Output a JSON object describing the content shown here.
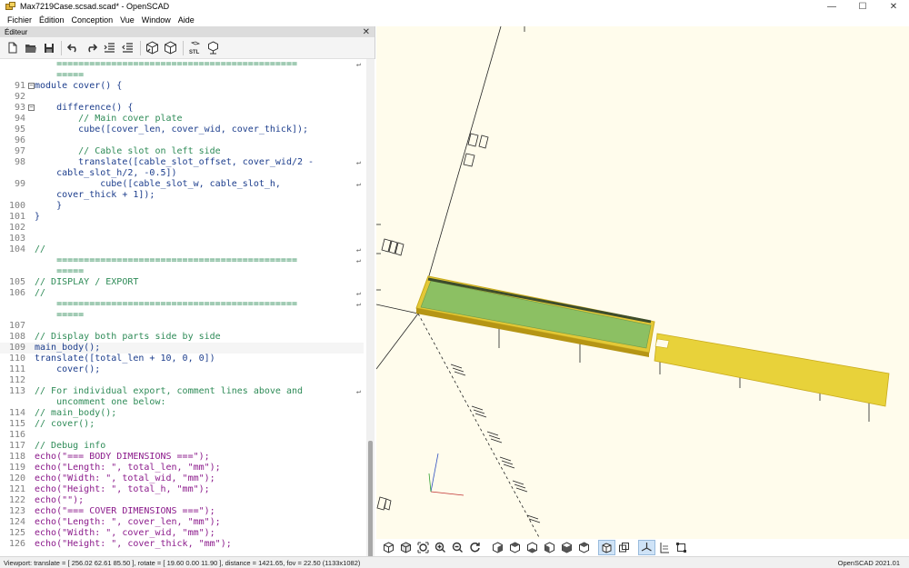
{
  "window": {
    "title": "Max7219Case.scsad.scad* - OpenSCAD",
    "minimize": "—",
    "maximize": "☐",
    "close": "✕"
  },
  "menu": [
    "Fichier",
    "Édition",
    "Conception",
    "Vue",
    "Window",
    "Aide"
  ],
  "editor": {
    "title": "Éditeur",
    "close": "✕",
    "toolbar_icons": [
      "new-file-icon",
      "open-file-icon",
      "save-icon",
      "undo-icon",
      "redo-icon",
      "indent-icon",
      "unindent-icon",
      "preview-icon",
      "render-icon",
      "export-stl-icon",
      "send-to-printer-icon"
    ],
    "lines": [
      {
        "ln": "",
        "text": "    ============================================",
        "cls": "c-comment",
        "wrap": true
      },
      {
        "ln": "",
        "text": "    =====",
        "cls": "c-comment"
      },
      {
        "ln": "91",
        "text": "module cover() {",
        "cls": "c-kw",
        "fold": "⊟"
      },
      {
        "ln": "92",
        "text": "",
        "cls": "c-plain"
      },
      {
        "ln": "93",
        "text": "    difference() {",
        "cls": "c-kw",
        "fold": "⊟"
      },
      {
        "ln": "94",
        "text": "        // Main cover plate",
        "cls": "c-comment"
      },
      {
        "ln": "95",
        "text": "        cube([cover_len, cover_wid, cover_thick]);",
        "cls": "c-kw"
      },
      {
        "ln": "96",
        "text": "",
        "cls": "c-plain"
      },
      {
        "ln": "97",
        "text": "        // Cable slot on left side",
        "cls": "c-comment"
      },
      {
        "ln": "98",
        "text": "        translate([cable_slot_offset, cover_wid/2 -",
        "cls": "c-kw",
        "wrap": true
      },
      {
        "ln": "",
        "text": "    cable_slot_h/2, -0.5])",
        "cls": "c-kw"
      },
      {
        "ln": "99",
        "text": "            cube([cable_slot_w, cable_slot_h,",
        "cls": "c-kw",
        "wrap": true
      },
      {
        "ln": "",
        "text": "    cover_thick + 1]);",
        "cls": "c-kw"
      },
      {
        "ln": "100",
        "text": "    }",
        "cls": "c-kw"
      },
      {
        "ln": "101",
        "text": "}",
        "cls": "c-kw"
      },
      {
        "ln": "102",
        "text": "",
        "cls": "c-plain"
      },
      {
        "ln": "103",
        "text": "",
        "cls": "c-plain"
      },
      {
        "ln": "104",
        "text": "//",
        "cls": "c-comment",
        "wrap": true
      },
      {
        "ln": "",
        "text": "    ============================================",
        "cls": "c-comment",
        "wrap": true
      },
      {
        "ln": "",
        "text": "    =====",
        "cls": "c-comment"
      },
      {
        "ln": "105",
        "text": "// DISPLAY / EXPORT",
        "cls": "c-comment"
      },
      {
        "ln": "106",
        "text": "//",
        "cls": "c-comment",
        "wrap": true
      },
      {
        "ln": "",
        "text": "    ============================================",
        "cls": "c-comment",
        "wrap": true
      },
      {
        "ln": "",
        "text": "    =====",
        "cls": "c-comment"
      },
      {
        "ln": "107",
        "text": "",
        "cls": "c-plain"
      },
      {
        "ln": "108",
        "text": "// Display both parts side by side",
        "cls": "c-comment"
      },
      {
        "ln": "109",
        "text": "main_body();",
        "cls": "c-kw",
        "current": true
      },
      {
        "ln": "110",
        "text": "translate([total_len + 10, 0, 0])",
        "cls": "c-kw"
      },
      {
        "ln": "111",
        "text": "    cover();",
        "cls": "c-kw"
      },
      {
        "ln": "112",
        "text": "",
        "cls": "c-plain"
      },
      {
        "ln": "113",
        "text": "// For individual export, comment lines above and",
        "cls": "c-comment",
        "wrap": true
      },
      {
        "ln": "",
        "text": "    uncomment one below:",
        "cls": "c-comment"
      },
      {
        "ln": "114",
        "text": "// main_body();",
        "cls": "c-comment"
      },
      {
        "ln": "115",
        "text": "// cover();",
        "cls": "c-comment"
      },
      {
        "ln": "116",
        "text": "",
        "cls": "c-plain"
      },
      {
        "ln": "117",
        "text": "// Debug info",
        "cls": "c-comment"
      },
      {
        "ln": "118",
        "text": "echo(\"=== BODY DIMENSIONS ===\");",
        "cls": "c-str"
      },
      {
        "ln": "119",
        "text": "echo(\"Length: \", total_len, \"mm\");",
        "cls": "c-str"
      },
      {
        "ln": "120",
        "text": "echo(\"Width: \", total_wid, \"mm\");",
        "cls": "c-str"
      },
      {
        "ln": "121",
        "text": "echo(\"Height: \", total_h, \"mm\");",
        "cls": "c-str"
      },
      {
        "ln": "122",
        "text": "echo(\"\");",
        "cls": "c-str"
      },
      {
        "ln": "123",
        "text": "echo(\"=== COVER DIMENSIONS ===\");",
        "cls": "c-str"
      },
      {
        "ln": "124",
        "text": "echo(\"Length: \", cover_len, \"mm\");",
        "cls": "c-str"
      },
      {
        "ln": "125",
        "text": "echo(\"Width: \", cover_wid, \"mm\");",
        "cls": "c-str"
      },
      {
        "ln": "126",
        "text": "echo(\"Height: \", cover_thick, \"mm\");",
        "cls": "c-str"
      }
    ]
  },
  "viewport": {
    "background": "#fffcec",
    "body_color": "#e8d23a",
    "body_top_color": "#8cc063",
    "toolbar_icons": [
      "preview-view-icon",
      "render-view-icon",
      "zoom-all-icon",
      "zoom-in-icon",
      "zoom-out-icon",
      "reset-view-icon",
      "view-right-icon",
      "view-top-icon",
      "view-bottom-icon",
      "view-left-icon",
      "view-front-icon",
      "view-back-icon",
      "perspective-icon",
      "orthogonal-icon",
      "show-axes-icon",
      "show-scale-icon",
      "show-edges-icon"
    ],
    "active_icons": [
      "perspective-icon",
      "show-axes-icon"
    ]
  },
  "status": {
    "viewport": "Viewport: translate = [ 256.02 62.61 85.50 ], rotate = [ 19.60 0.00 11.90 ], distance = 1421.65, fov = 22.50 (1133x1082)",
    "version": "OpenSCAD 2021.01"
  }
}
